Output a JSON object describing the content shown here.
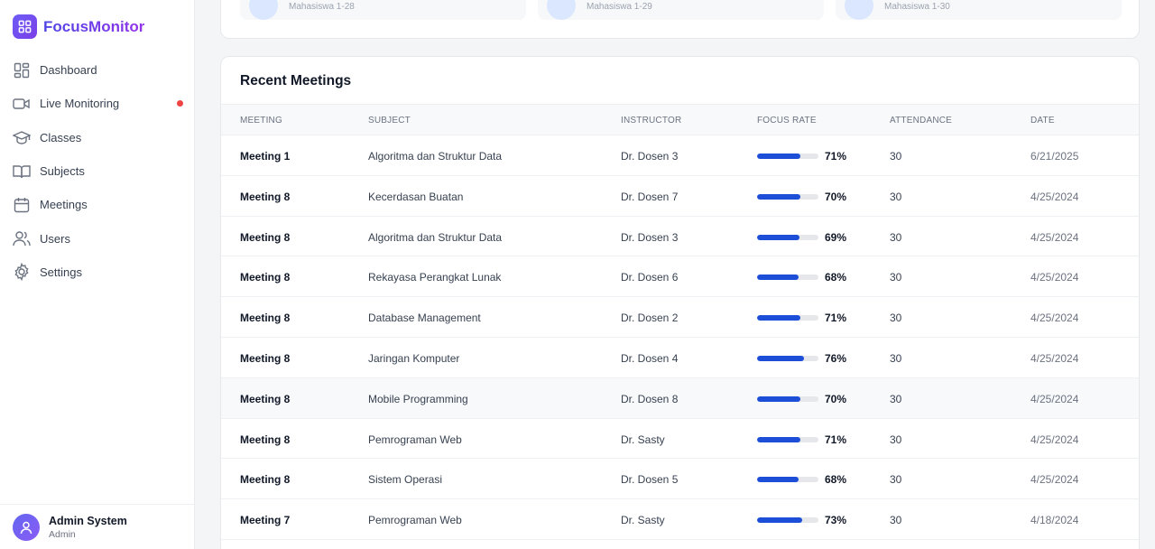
{
  "app": {
    "name": "FocusMonitor"
  },
  "sidebar": {
    "items": [
      {
        "label": "Dashboard",
        "icon": "dashboard-icon"
      },
      {
        "label": "Live Monitoring",
        "icon": "video-icon",
        "live": true
      },
      {
        "label": "Classes",
        "icon": "graduation-cap-icon"
      },
      {
        "label": "Subjects",
        "icon": "book-icon"
      },
      {
        "label": "Meetings",
        "icon": "calendar-icon"
      },
      {
        "label": "Users",
        "icon": "users-icon"
      },
      {
        "label": "Settings",
        "icon": "gear-icon"
      }
    ],
    "user": {
      "name": "Admin System",
      "role": "Admin"
    }
  },
  "top_cards": [
    {
      "label": "Mahasiswa 1-28"
    },
    {
      "label": "Mahasiswa 1-29"
    },
    {
      "label": "Mahasiswa 1-30"
    }
  ],
  "recent_meetings": {
    "title": "Recent Meetings",
    "columns": [
      "MEETING",
      "SUBJECT",
      "INSTRUCTOR",
      "FOCUS RATE",
      "ATTENDANCE",
      "DATE"
    ],
    "rows": [
      {
        "meeting": "Meeting 1",
        "subject": "Algoritma dan Struktur Data",
        "instructor": "Dr. Dosen 3",
        "focus": 71,
        "focus_label": "71%",
        "attendance": "30",
        "date": "6/21/2025"
      },
      {
        "meeting": "Meeting 8",
        "subject": "Kecerdasan Buatan",
        "instructor": "Dr. Dosen 7",
        "focus": 70,
        "focus_label": "70%",
        "attendance": "30",
        "date": "4/25/2024"
      },
      {
        "meeting": "Meeting 8",
        "subject": "Algoritma dan Struktur Data",
        "instructor": "Dr. Dosen 3",
        "focus": 69,
        "focus_label": "69%",
        "attendance": "30",
        "date": "4/25/2024"
      },
      {
        "meeting": "Meeting 8",
        "subject": "Rekayasa Perangkat Lunak",
        "instructor": "Dr. Dosen 6",
        "focus": 68,
        "focus_label": "68%",
        "attendance": "30",
        "date": "4/25/2024"
      },
      {
        "meeting": "Meeting 8",
        "subject": "Database Management",
        "instructor": "Dr. Dosen 2",
        "focus": 71,
        "focus_label": "71%",
        "attendance": "30",
        "date": "4/25/2024"
      },
      {
        "meeting": "Meeting 8",
        "subject": "Jaringan Komputer",
        "instructor": "Dr. Dosen 4",
        "focus": 76,
        "focus_label": "76%",
        "attendance": "30",
        "date": "4/25/2024"
      },
      {
        "meeting": "Meeting 8",
        "subject": "Mobile Programming",
        "instructor": "Dr. Dosen 8",
        "focus": 70,
        "focus_label": "70%",
        "attendance": "30",
        "date": "4/25/2024",
        "highlighted": true
      },
      {
        "meeting": "Meeting 8",
        "subject": "Pemrograman Web",
        "instructor": "Dr. Sasty",
        "focus": 71,
        "focus_label": "71%",
        "attendance": "30",
        "date": "4/25/2024"
      },
      {
        "meeting": "Meeting 8",
        "subject": "Sistem Operasi",
        "instructor": "Dr. Dosen 5",
        "focus": 68,
        "focus_label": "68%",
        "attendance": "30",
        "date": "4/25/2024"
      },
      {
        "meeting": "Meeting 7",
        "subject": "Pemrograman Web",
        "instructor": "Dr. Sasty",
        "focus": 73,
        "focus_label": "73%",
        "attendance": "30",
        "date": "4/18/2024"
      }
    ]
  },
  "colors": {
    "accent": "#1d4ed8",
    "brand_start": "#4f46e5",
    "brand_end": "#9333ea",
    "live": "#ef4444"
  }
}
